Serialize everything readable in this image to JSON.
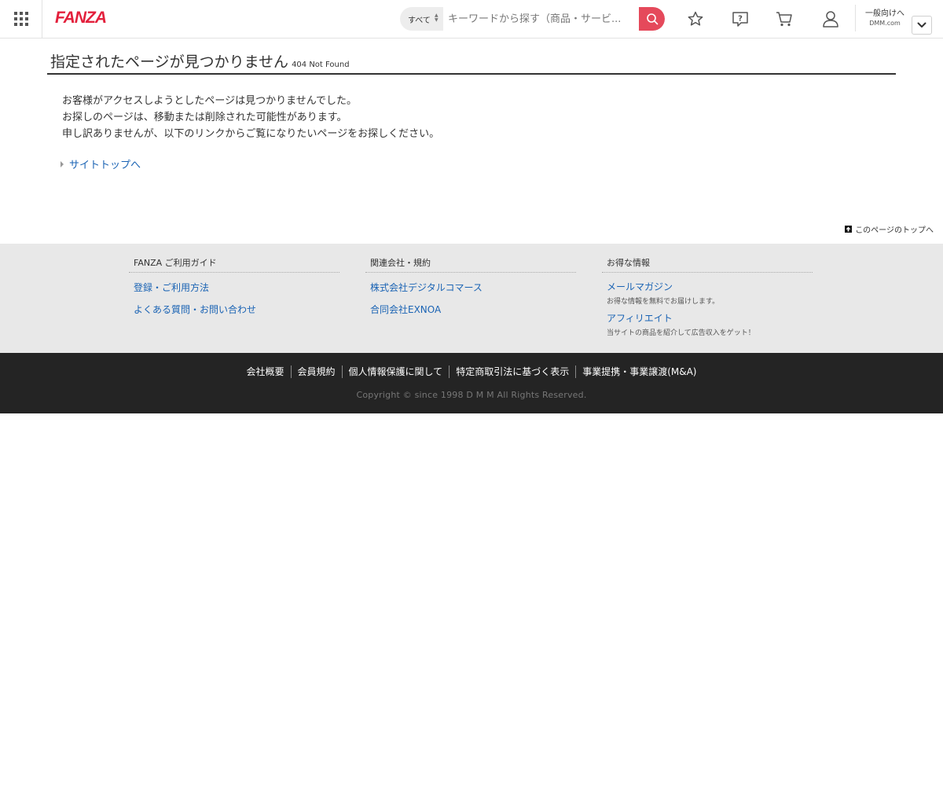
{
  "header": {
    "logo": "FANZA",
    "search": {
      "category": "すべて",
      "placeholder": "キーワードから探す（商品・サービ..."
    },
    "general_link": {
      "line1": "一般向けへ",
      "line2": "DMM.com"
    }
  },
  "main": {
    "title": "指定されたページが見つかりません",
    "subtitle": "404 Not Found",
    "messages": [
      "お客様がアクセスしようとしたページは見つかりませんでした。",
      "お探しのページは、移動または削除された可能性があります。",
      "申し訳ありませんが、以下のリンクからご覧になりたいページをお探しください。"
    ],
    "site_top_link": "サイトトップへ",
    "page_top_link": "このページのトップへ"
  },
  "footer": {
    "columns": [
      {
        "heading": "FANZA ご利用ガイド",
        "links": [
          "登録・ご利用方法",
          "よくある質問・お問い合わせ"
        ]
      },
      {
        "heading": "関連会社・規約",
        "links": [
          "株式会社デジタルコマース",
          "合同会社EXNOA"
        ]
      },
      {
        "heading": "お得な情報",
        "links": [
          {
            "label": "メールマガジン",
            "desc": "お得な情報を無料でお届けします。"
          },
          {
            "label": "アフィリエイト",
            "desc": "当サイトの商品を紹介して広告収入をゲット！"
          }
        ]
      }
    ],
    "bottom_links": [
      "会社概要",
      "会員規約",
      "個人情報保護に関して",
      "特定商取引法に基づく表示",
      "事業提携・事業譲渡(M&A)"
    ],
    "copyright": "Copyright © since 1998 D M M All Rights Reserved."
  },
  "colors": {
    "brand": "#e3203c",
    "search_button": "#e5495b",
    "link": "#1a63b4",
    "footer_dark": "#242424",
    "footer_light": "#e8e8e8"
  },
  "icons": [
    "menu-grid-icon",
    "search-icon",
    "star-icon",
    "help-icon",
    "cart-icon",
    "user-icon",
    "chevron-down-icon"
  ]
}
